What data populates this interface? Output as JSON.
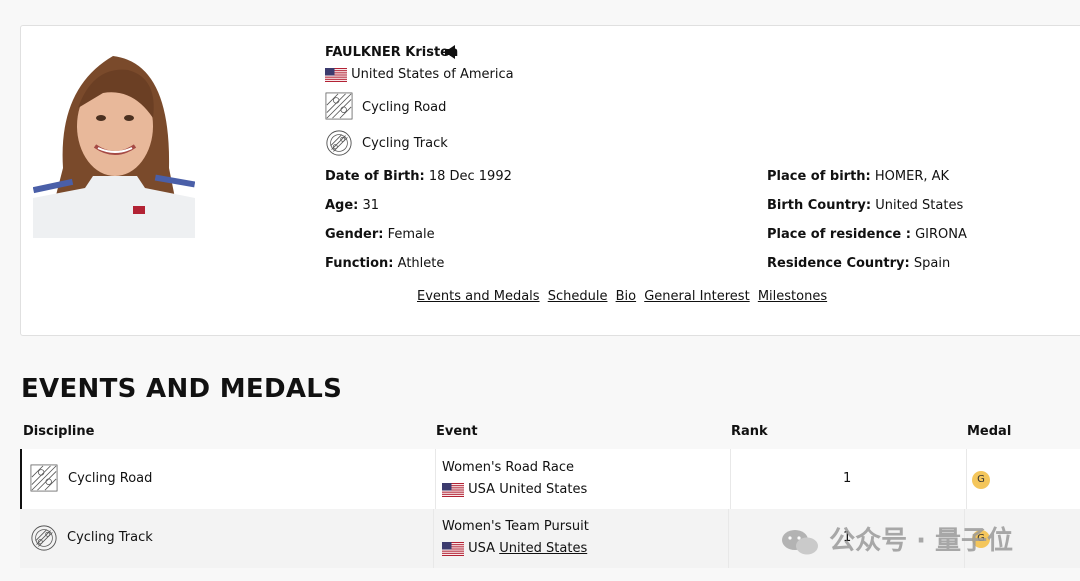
{
  "athlete": {
    "name": "FAULKNER Kristen",
    "country": "United States of America",
    "disciplines": [
      "Cycling Road",
      "Cycling Track"
    ]
  },
  "details_left": [
    {
      "label": "Date of Birth:",
      "value": "18 Dec 1992"
    },
    {
      "label": "Age:",
      "value": "31"
    },
    {
      "label": "Gender:",
      "value": "Female"
    },
    {
      "label": "Function:",
      "value": "Athlete"
    }
  ],
  "details_right": [
    {
      "label": "Place of birth:",
      "value": "HOMER, AK"
    },
    {
      "label": "Birth Country:",
      "value": "United States"
    },
    {
      "label": "Place of residence :",
      "value": "GIRONA"
    },
    {
      "label": "Residence Country:",
      "value": "Spain"
    }
  ],
  "links": [
    "Events and Medals",
    "Schedule",
    "Bio",
    "General Interest",
    "Milestones"
  ],
  "section": {
    "title": "EVENTS AND MEDALS",
    "headers": [
      "Discipline",
      "Event",
      "Rank",
      "Medal"
    ],
    "rows": [
      {
        "discipline": "Cycling Road",
        "event": "Women's Road Race",
        "noc": "USA",
        "team": "United States",
        "rank": "1",
        "medal": "G"
      },
      {
        "discipline": "Cycling Track",
        "event": "Women's Team Pursuit",
        "noc": "USA",
        "team": "United States",
        "rank": "1",
        "medal": "G"
      }
    ]
  },
  "watermark": "公众号 · 量子位",
  "colors": {
    "gold": "#f4c65b",
    "flag_red": "#b22234",
    "flag_blue": "#3c3b6e"
  }
}
